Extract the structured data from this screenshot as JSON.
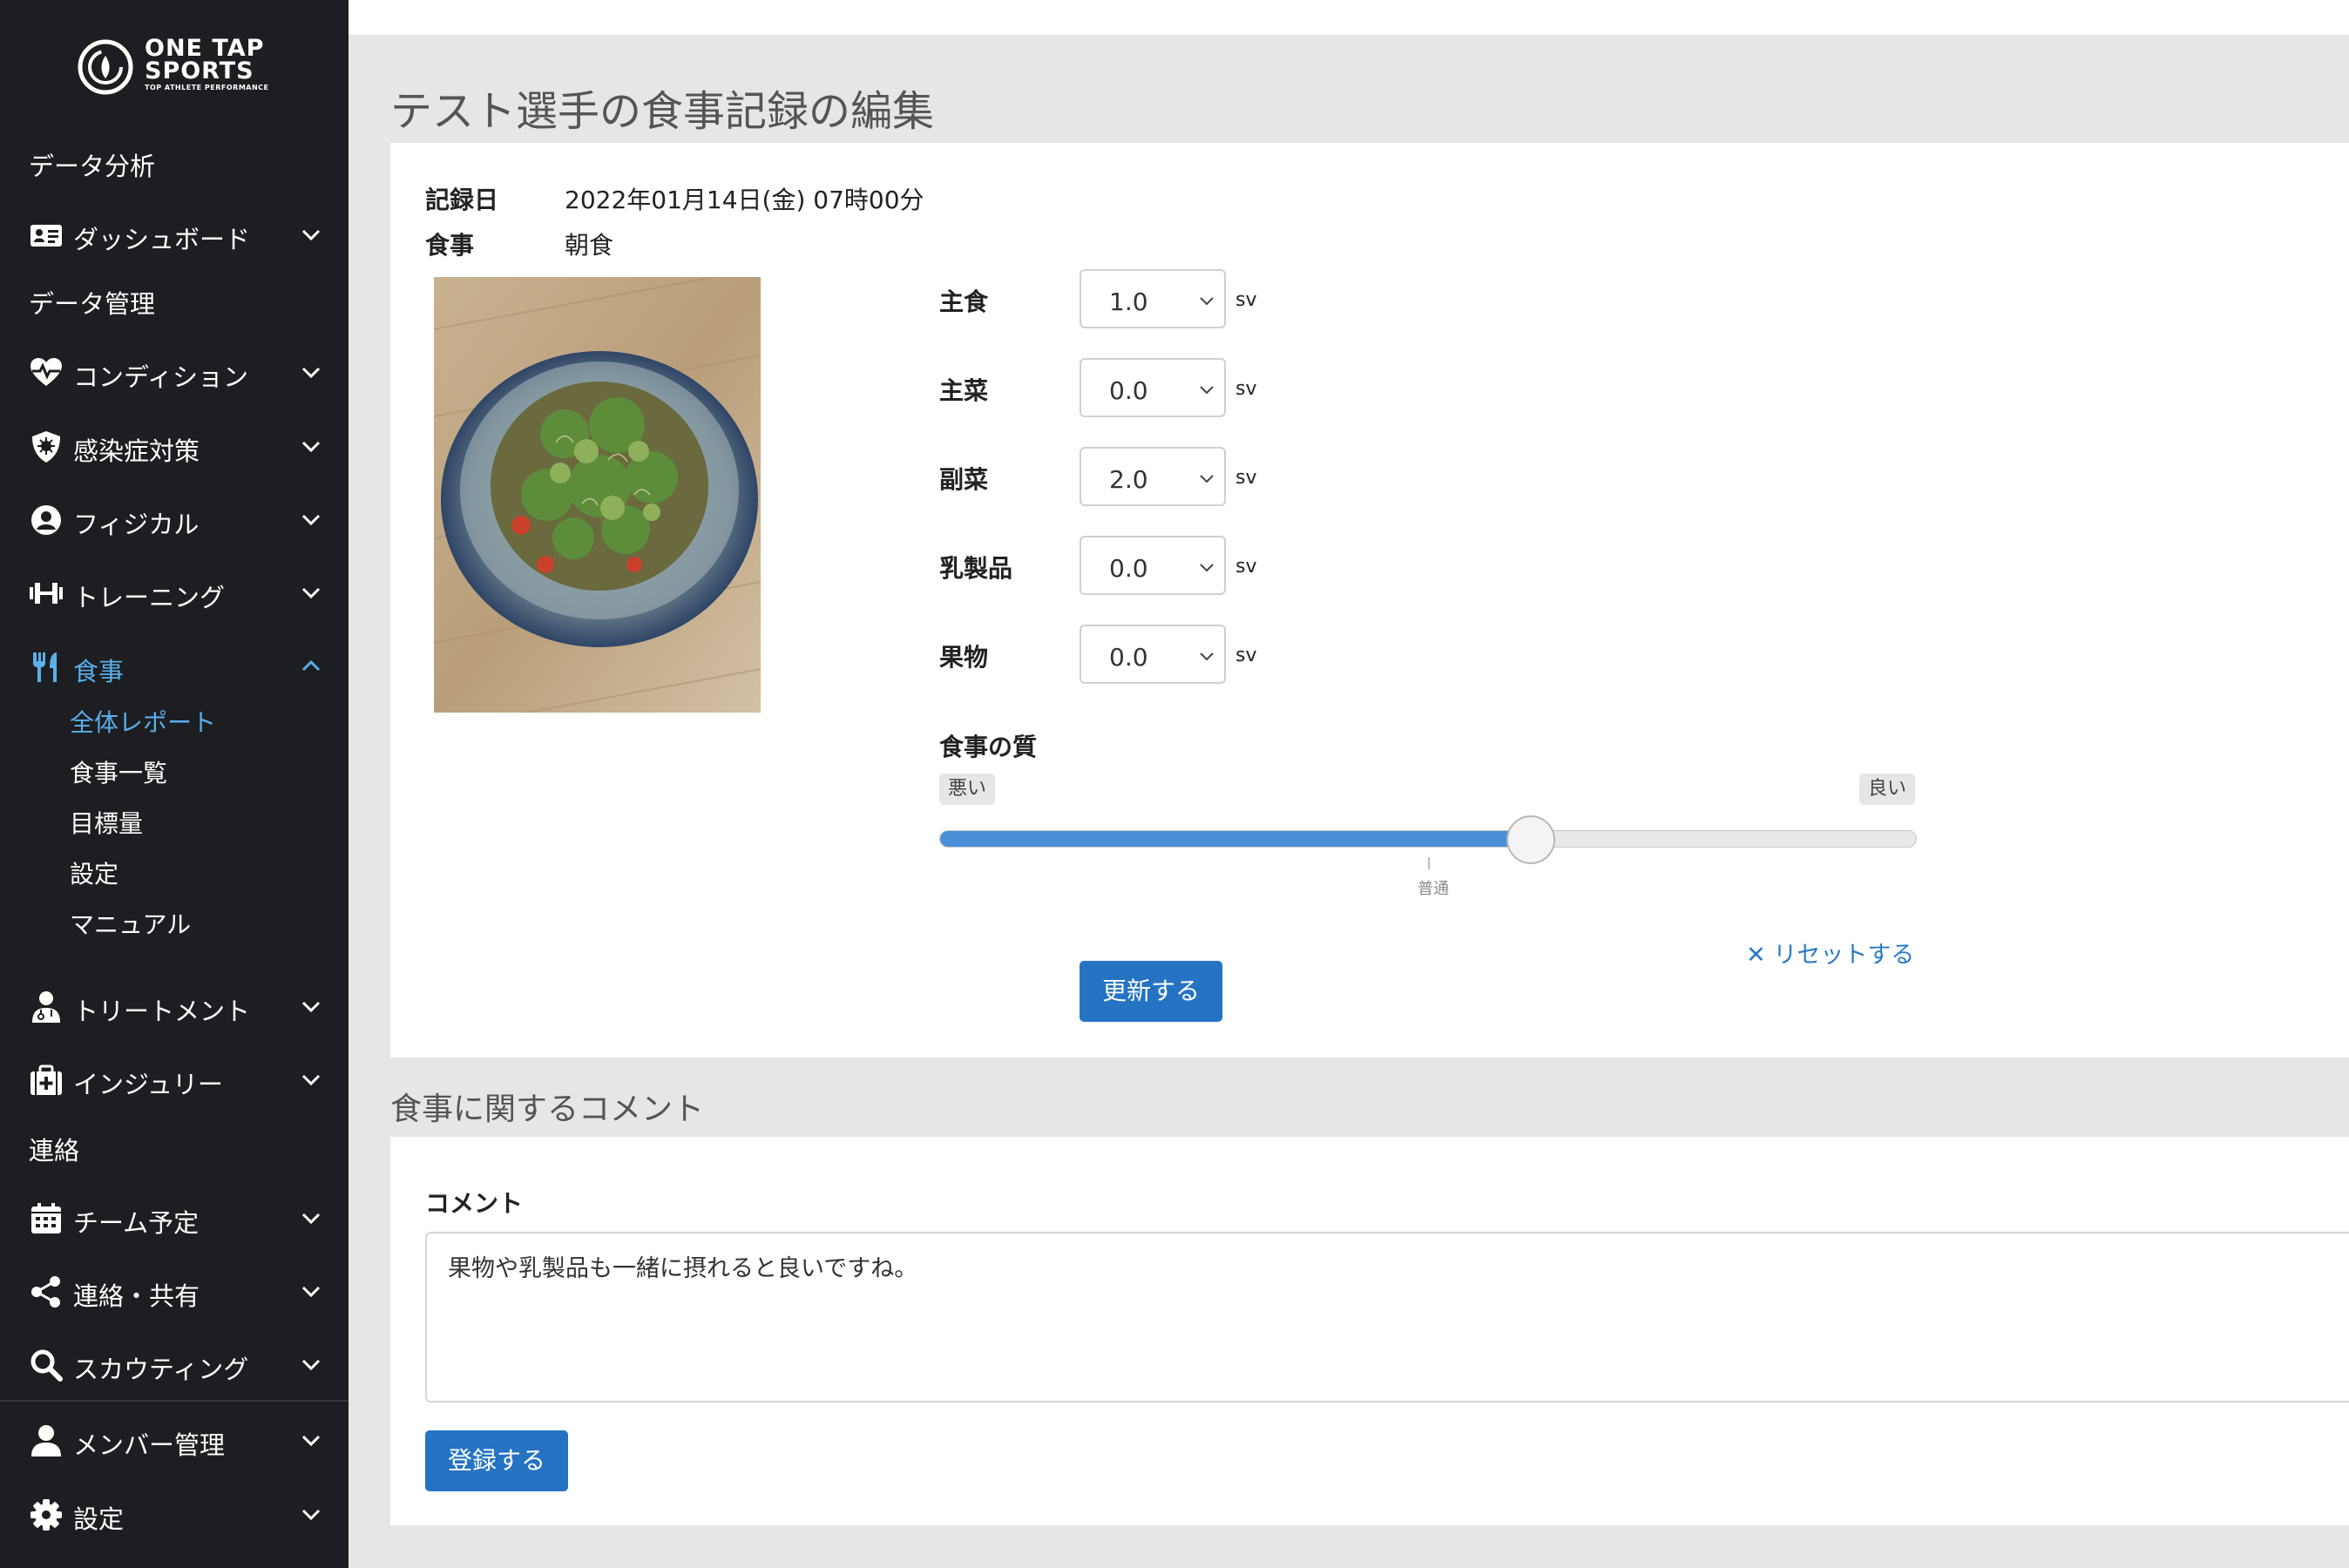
{
  "brand": {
    "line1": "ONE TAP",
    "line2": "SPORTS",
    "tagline": "TOP ATHLETE PERFORMANCE"
  },
  "sidebar": {
    "section_analysis": "データ分析",
    "section_data": "データ管理",
    "section_contact": "連絡",
    "items": [
      {
        "label": "ダッシュボード",
        "icon": "id-card-icon"
      },
      {
        "label": "コンディション",
        "icon": "heart-pulse-icon"
      },
      {
        "label": "感染症対策",
        "icon": "shield-virus-icon"
      },
      {
        "label": "フィジカル",
        "icon": "user-circle-icon"
      },
      {
        "label": "トレーニング",
        "icon": "dumbbell-icon"
      },
      {
        "label": "食事",
        "icon": "utensils-icon"
      },
      {
        "label": "トリートメント",
        "icon": "user-doctor-icon"
      },
      {
        "label": "インジュリー",
        "icon": "medical-kit-icon"
      },
      {
        "label": "チーム予定",
        "icon": "calendar-icon"
      },
      {
        "label": "連絡・共有",
        "icon": "share-icon"
      },
      {
        "label": "スカウティング",
        "icon": "search-icon"
      },
      {
        "label": "メンバー管理",
        "icon": "user-icon"
      },
      {
        "label": "設定",
        "icon": "gear-icon"
      }
    ],
    "meal_sub": [
      "全体レポート",
      "食事一覧",
      "目標量",
      "設定",
      "マニュアル"
    ]
  },
  "page": {
    "title": "テスト選手の食事記録の編集"
  },
  "record": {
    "date_label": "記録日",
    "date_value": "2022年01月14日(金) 07時00分",
    "meal_label": "食事",
    "meal_value": "朝食"
  },
  "servings": [
    {
      "label": "主食",
      "value": "1.0",
      "unit": "sv"
    },
    {
      "label": "主菜",
      "value": "0.0",
      "unit": "sv"
    },
    {
      "label": "副菜",
      "value": "2.0",
      "unit": "sv"
    },
    {
      "label": "乳製品",
      "value": "0.0",
      "unit": "sv"
    },
    {
      "label": "果物",
      "value": "0.0",
      "unit": "sv"
    }
  ],
  "quality": {
    "label": "食事の質",
    "min_label": "悪い",
    "max_label": "良い",
    "mid_label": "普通",
    "level": 0.605
  },
  "actions": {
    "reset": "✕ リセットする",
    "update": "更新する",
    "register": "登録する"
  },
  "comment": {
    "section_title": "食事に関するコメント",
    "label": "コメント",
    "value": "果物や乳製品も一緒に摂れると良いですね。"
  },
  "colors": {
    "accent": "#2673c4",
    "sidebar_bg": "#1c1e21",
    "active": "#5aaeea"
  }
}
